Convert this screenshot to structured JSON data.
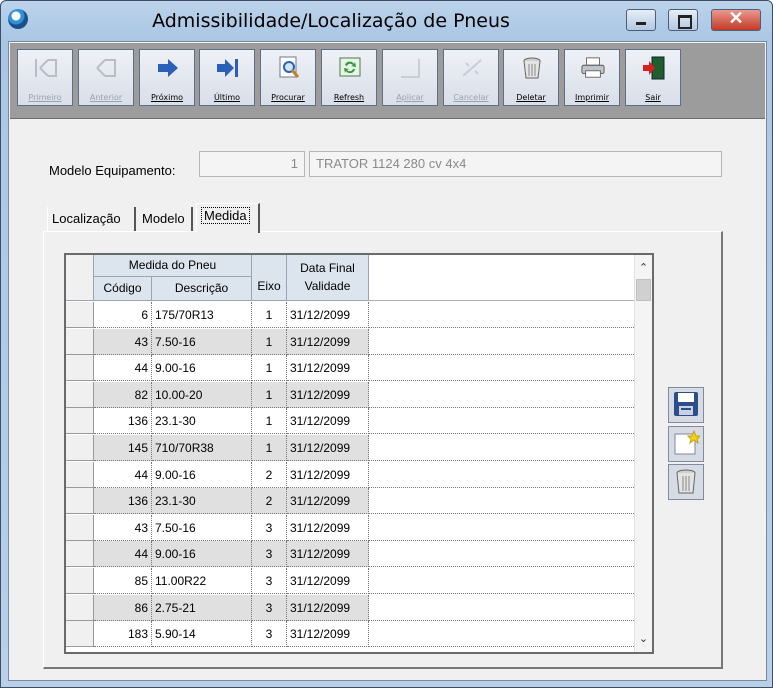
{
  "window": {
    "title": "Admissibilidade/Localização de Pneus",
    "close_glyph": "✕"
  },
  "toolbar": {
    "buttons": [
      {
        "label": "Primeiro",
        "icon": "first-icon",
        "enabled": false
      },
      {
        "label": "Anterior",
        "icon": "previous-icon",
        "enabled": false
      },
      {
        "label": "Próximo",
        "icon": "next-icon",
        "enabled": true
      },
      {
        "label": "Último",
        "icon": "last-icon",
        "enabled": true
      },
      {
        "label": "Procurar",
        "icon": "search-icon",
        "enabled": true
      },
      {
        "label": "Refresh",
        "icon": "refresh-icon",
        "enabled": true
      },
      {
        "label": "Aplicar",
        "icon": "apply-icon",
        "enabled": false
      },
      {
        "label": "Cancelar",
        "icon": "cancel-icon",
        "enabled": false
      },
      {
        "label": "Deletar",
        "icon": "trash-icon",
        "enabled": true
      },
      {
        "label": "Imprimir",
        "icon": "printer-icon",
        "enabled": true
      },
      {
        "label": "Sair",
        "icon": "exit-door-icon",
        "enabled": true
      }
    ]
  },
  "form": {
    "modelo_label": "Modelo Equipamento:",
    "modelo_code": "1",
    "modelo_desc": "TRATOR 1124 280 cv 4x4"
  },
  "tabs": [
    {
      "label": "Localização",
      "active": false
    },
    {
      "label": "Modelo",
      "active": false
    },
    {
      "label": "Medida",
      "active": true
    }
  ],
  "grid": {
    "group_header": "Medida do Pneu",
    "headers": {
      "codigo": "Código",
      "descricao": "Descrição",
      "eixo": "Eixo",
      "data_line1": "Data Final",
      "data_line2": "Validade"
    },
    "rows": [
      {
        "codigo": "6",
        "descricao": "175/70R13",
        "eixo": "1",
        "data": "31/12/2099"
      },
      {
        "codigo": "43",
        "descricao": "7.50-16",
        "eixo": "1",
        "data": "31/12/2099"
      },
      {
        "codigo": "44",
        "descricao": "9.00-16",
        "eixo": "1",
        "data": "31/12/2099"
      },
      {
        "codigo": "82",
        "descricao": "10.00-20",
        "eixo": "1",
        "data": "31/12/2099"
      },
      {
        "codigo": "136",
        "descricao": "23.1-30",
        "eixo": "1",
        "data": "31/12/2099"
      },
      {
        "codigo": "145",
        "descricao": "710/70R38",
        "eixo": "1",
        "data": "31/12/2099"
      },
      {
        "codigo": "44",
        "descricao": "9.00-16",
        "eixo": "2",
        "data": "31/12/2099"
      },
      {
        "codigo": "136",
        "descricao": "23.1-30",
        "eixo": "2",
        "data": "31/12/2099"
      },
      {
        "codigo": "43",
        "descricao": "7.50-16",
        "eixo": "3",
        "data": "31/12/2099"
      },
      {
        "codigo": "44",
        "descricao": "9.00-16",
        "eixo": "3",
        "data": "31/12/2099"
      },
      {
        "codigo": "85",
        "descricao": "11.00R22",
        "eixo": "3",
        "data": "31/12/2099"
      },
      {
        "codigo": "86",
        "descricao": "2.75-21",
        "eixo": "3",
        "data": "31/12/2099"
      },
      {
        "codigo": "183",
        "descricao": "5.90-14",
        "eixo": "3",
        "data": "31/12/2099"
      }
    ]
  },
  "side_buttons": [
    {
      "icon": "save-floppy-icon"
    },
    {
      "icon": "new-record-icon"
    },
    {
      "icon": "trash-icon"
    }
  ],
  "scroll": {
    "up_glyph": "⌃",
    "down_glyph": "⌄"
  }
}
